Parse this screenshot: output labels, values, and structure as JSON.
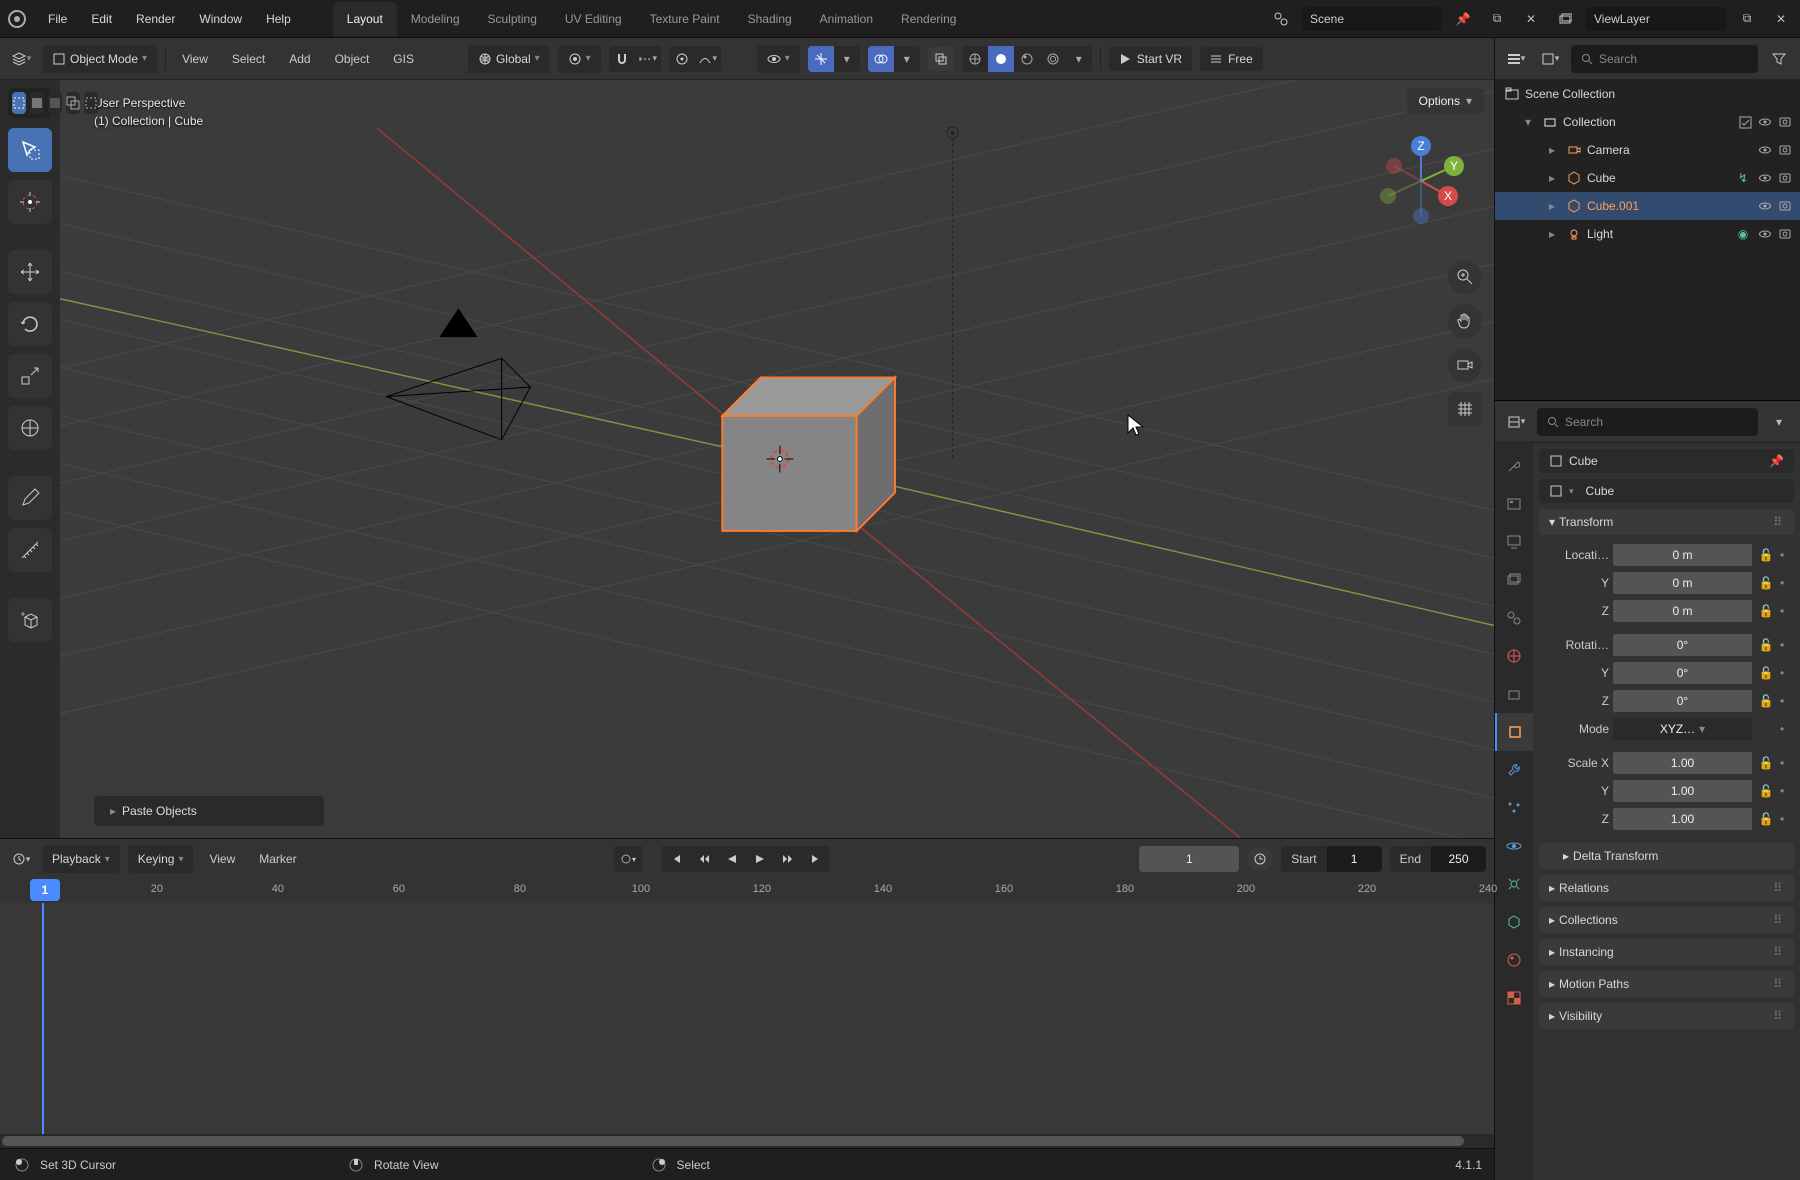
{
  "app": {
    "version": "4.1.1"
  },
  "topbar": {
    "menus": [
      "File",
      "Edit",
      "Render",
      "Window",
      "Help"
    ],
    "tabs": [
      "Layout",
      "Modeling",
      "Sculpting",
      "UV Editing",
      "Texture Paint",
      "Shading",
      "Animation",
      "Rendering"
    ],
    "active_tab": "Layout",
    "scene_label": "Scene",
    "viewlayer_label": "ViewLayer"
  },
  "viewport_header": {
    "mode": "Object Mode",
    "menus": [
      "View",
      "Select",
      "Add",
      "Object",
      "GIS"
    ],
    "orientation": "Global",
    "startvr": "Start VR",
    "free": "Free"
  },
  "viewport": {
    "perspective": "User Perspective",
    "context": "(1) Collection | Cube",
    "options": "Options",
    "toast": "Paste Objects"
  },
  "timeline": {
    "menus": [
      "Playback",
      "Keying",
      "View",
      "Marker"
    ],
    "current_frame": "1",
    "start_label": "Start",
    "start_value": "1",
    "end_label": "End",
    "end_value": "250",
    "ticks": [
      "20",
      "40",
      "60",
      "80",
      "100",
      "120",
      "140",
      "160",
      "180",
      "200",
      "220",
      "240"
    ],
    "playhead": "1"
  },
  "statusbar": {
    "left": "Set 3D Cursor",
    "middle": "Rotate View",
    "right": "Select"
  },
  "outliner": {
    "search_placeholder": "Search",
    "root": "Scene Collection",
    "collection": "Collection",
    "items": [
      {
        "name": "Camera",
        "type": "camera",
        "selected": false
      },
      {
        "name": "Cube",
        "type": "mesh",
        "selected": false
      },
      {
        "name": "Cube.001",
        "type": "mesh",
        "selected": true
      },
      {
        "name": "Light",
        "type": "light",
        "selected": false
      }
    ]
  },
  "properties": {
    "search_placeholder": "Search",
    "crumb_obj": "Cube",
    "name_field": "Cube",
    "panels": {
      "transform": {
        "title": "Transform",
        "location_label": "Locati…",
        "rotation_label": "Rotati…",
        "scale_label": "Scale X",
        "mode_label": "Mode",
        "mode_value": "XYZ…",
        "loc": [
          "0 m",
          "0 m",
          "0 m"
        ],
        "rot": [
          "0°",
          "0°",
          "0°"
        ],
        "scale": [
          "1.00",
          "1.00",
          "1.00"
        ],
        "axis_y": "Y",
        "axis_z": "Z"
      },
      "closed": [
        "Delta Transform",
        "Relations",
        "Collections",
        "Instancing",
        "Motion Paths",
        "Visibility"
      ]
    }
  }
}
